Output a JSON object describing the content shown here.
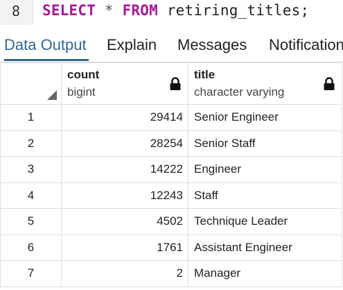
{
  "editor": {
    "line_number": "8",
    "keyword_select": "SELECT",
    "star": "*",
    "keyword_from": "FROM",
    "table_name": "retiring_titles;"
  },
  "tabs": [
    {
      "label": "Data Output",
      "active": true
    },
    {
      "label": "Explain",
      "active": false
    },
    {
      "label": "Messages",
      "active": false
    },
    {
      "label": "Notifications",
      "active": false
    }
  ],
  "grid": {
    "columns": [
      {
        "name": "count",
        "type": "bigint",
        "icon": "lock-icon"
      },
      {
        "name": "title",
        "type": "character varying",
        "icon": "lock-icon"
      }
    ],
    "rows": [
      {
        "num": "1",
        "count": "29414",
        "title": "Senior Engineer"
      },
      {
        "num": "2",
        "count": "28254",
        "title": "Senior Staff"
      },
      {
        "num": "3",
        "count": "14222",
        "title": "Engineer"
      },
      {
        "num": "4",
        "count": "12243",
        "title": "Staff"
      },
      {
        "num": "5",
        "count": "4502",
        "title": "Technique Leader"
      },
      {
        "num": "6",
        "count": "1761",
        "title": "Assistant Engineer"
      },
      {
        "num": "7",
        "count": "2",
        "title": "Manager"
      }
    ]
  },
  "colors": {
    "keyword": "#a21b95",
    "active_tab": "#326690"
  }
}
